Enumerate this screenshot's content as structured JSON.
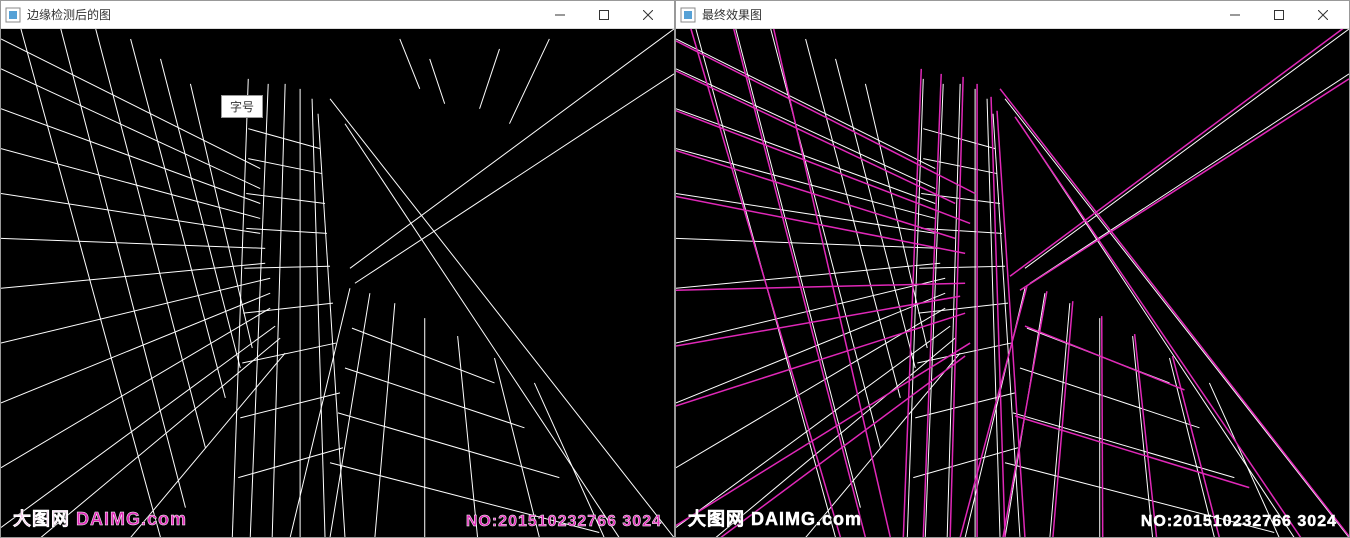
{
  "window_left": {
    "title": "边缘检测后的图",
    "tooltip": "字号",
    "watermark_left": "大图网 DAIMG.com",
    "watermark_right": "NO:201510232766 3024"
  },
  "window_right": {
    "title": "最终效果图",
    "watermark_left": "大图网 DAIMG.com",
    "watermark_right": "NO:201510232766 3024"
  },
  "colors": {
    "edge": "#ffffff",
    "hough": "#e028b8",
    "bg": "#000000"
  }
}
